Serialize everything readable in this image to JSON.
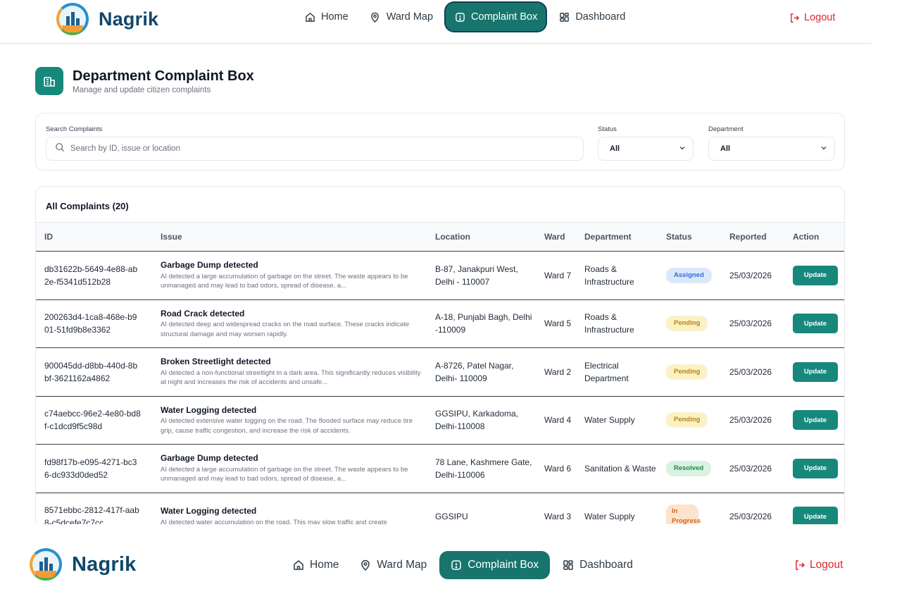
{
  "nav": {
    "brand": "Nagrik",
    "items": [
      {
        "label": "Home",
        "icon": "home-icon"
      },
      {
        "label": "Ward Map",
        "icon": "map-pin-icon"
      },
      {
        "label": "Complaint Box",
        "icon": "alert-box-icon"
      },
      {
        "label": "Dashboard",
        "icon": "grid-icon"
      }
    ],
    "active_index": 2,
    "logout": "Logout"
  },
  "header": {
    "title": "Department Complaint Box",
    "subtitle": "Manage and update citizen complaints"
  },
  "filters": {
    "search_label": "Search Complaints",
    "search_placeholder": "Search by ID, issue or location",
    "status_label": "Status",
    "status_value": "All",
    "department_label": "Department",
    "department_value": "All"
  },
  "table": {
    "title": "All Complaints (20)",
    "columns": [
      "ID",
      "Issue",
      "Location",
      "Ward",
      "Department",
      "Status",
      "Reported",
      "Action"
    ],
    "rows": [
      {
        "id": "db31622b-5649-4e88-ab2e-f5341d512b28",
        "issue_title": "Garbage Dump detected",
        "issue_desc": "AI detected a large accumulation of garbage on the street. The waste appears to be unmanaged and may lead to bad odors, spread of disease, a...",
        "location": "B-87, Janakpuri West, Delhi - 110007",
        "ward": "Ward 7",
        "department": "Roads & Infrastructure",
        "status": "Assigned",
        "reported": "25/03/2026",
        "action": "Update"
      },
      {
        "id": "200263d4-1ca8-468e-b901-51fd9b8e3362",
        "issue_title": "Road Crack detected",
        "issue_desc": "AI detected deep and widespread cracks on the road surface. These cracks indicate structural damage and may worsen rapidly.",
        "location": "A-18, Punjabi Bagh, Delhi -110009",
        "ward": "Ward 5",
        "department": "Roads & Infrastructure",
        "status": "Pending",
        "reported": "25/03/2026",
        "action": "Update"
      },
      {
        "id": "900045dd-d8bb-440d-8bbf-3621162a4862",
        "issue_title": "Broken Streetlight detected",
        "issue_desc": "AI detected a non-functional streetlight in a dark area. This significantly reduces visibility at night and increases the risk of accidents and unsafe...",
        "location": "A-8726, Patel Nagar, Delhi- 110009",
        "ward": "Ward 2",
        "department": "Electrical Department",
        "status": "Pending",
        "reported": "25/03/2026",
        "action": "Update"
      },
      {
        "id": "c74aebcc-96e2-4e80-bd8f-c1dcd9f5c98d",
        "issue_title": "Water Logging detected",
        "issue_desc": "AI detected extensive water logging on the road. The flooded surface may reduce tire grip, cause traffic congestion, and increase the risk of accidents.",
        "location": "GGSIPU, Karkadoma, Delhi-110008",
        "ward": "Ward 4",
        "department": "Water Supply",
        "status": "Pending",
        "reported": "25/03/2026",
        "action": "Update"
      },
      {
        "id": "fd98f17b-e095-4271-bc36-dc933d0ded52",
        "issue_title": "Garbage Dump detected",
        "issue_desc": "AI detected a large accumulation of garbage on the street. The waste appears to be unmanaged and may lead to bad odors, spread of disease, a...",
        "location": "78 Lane, Kashmere Gate, Delhi-110006",
        "ward": "Ward 6",
        "department": "Sanitation & Waste",
        "status": "Resolved",
        "reported": "25/03/2026",
        "action": "Update"
      },
      {
        "id": "8571ebbc-2812-417f-aab8-c5dcefe7c7cc",
        "issue_title": "Water Logging detected",
        "issue_desc": "AI detected water accumulation on the road. This may slow traffic and create",
        "location": "GGSIPU",
        "ward": "Ward 3",
        "department": "Water Supply",
        "status": "In Progress",
        "reported": "25/03/2026",
        "action": "Update"
      }
    ]
  },
  "colors": {
    "accent": "#17756e",
    "brand_text": "#12476b",
    "logout": "#e0242d"
  }
}
